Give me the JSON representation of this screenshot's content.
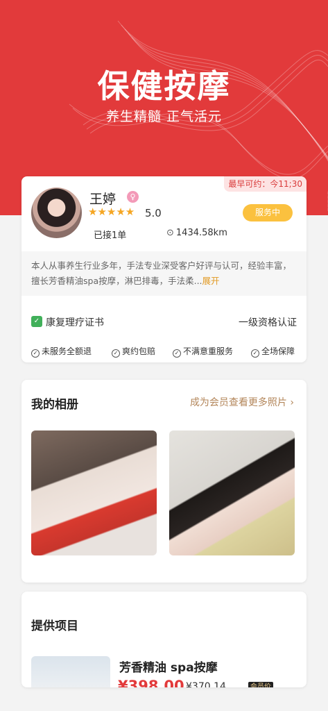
{
  "hero": {
    "title": "保健按摩",
    "subtitle": "养生精髓  正气活元"
  },
  "colors": {
    "brand_red": "#e23a3b",
    "status_yellow": "#fbc13f",
    "star_orange": "#f5a623",
    "link_gold": "#b3865a",
    "cert_green": "#41b05a"
  },
  "profile": {
    "earliest_label": "最早可约：今11;30",
    "name": "王婷",
    "gender_icon": "female-icon",
    "stars": "★★★★★",
    "score": "5.0",
    "status": "服务中",
    "orders": "已接1单",
    "distance": "1434.58km",
    "bio": "本人从事养生行业多年，手法专业深受客户好评与认可，经验丰富，擅长芳香精油spa按摩，淋巴排毒，手法柔...",
    "bio_more": "展开"
  },
  "certificate": {
    "icon": "certificate-icon",
    "name": "康复理疗证书",
    "level": "一级资格认证"
  },
  "guarantees": [
    "未服务全额退",
    "爽约包赔",
    "不满意重服务",
    "全场保障"
  ],
  "album": {
    "title": "我的相册",
    "more": "成为会员查看更多照片 ›"
  },
  "services": {
    "title": "提供项目",
    "items": [
      {
        "name": "芳香精油 spa按摩",
        "price": "¥398.00",
        "member_price": "¥370.14",
        "tag": "会员价"
      }
    ]
  }
}
